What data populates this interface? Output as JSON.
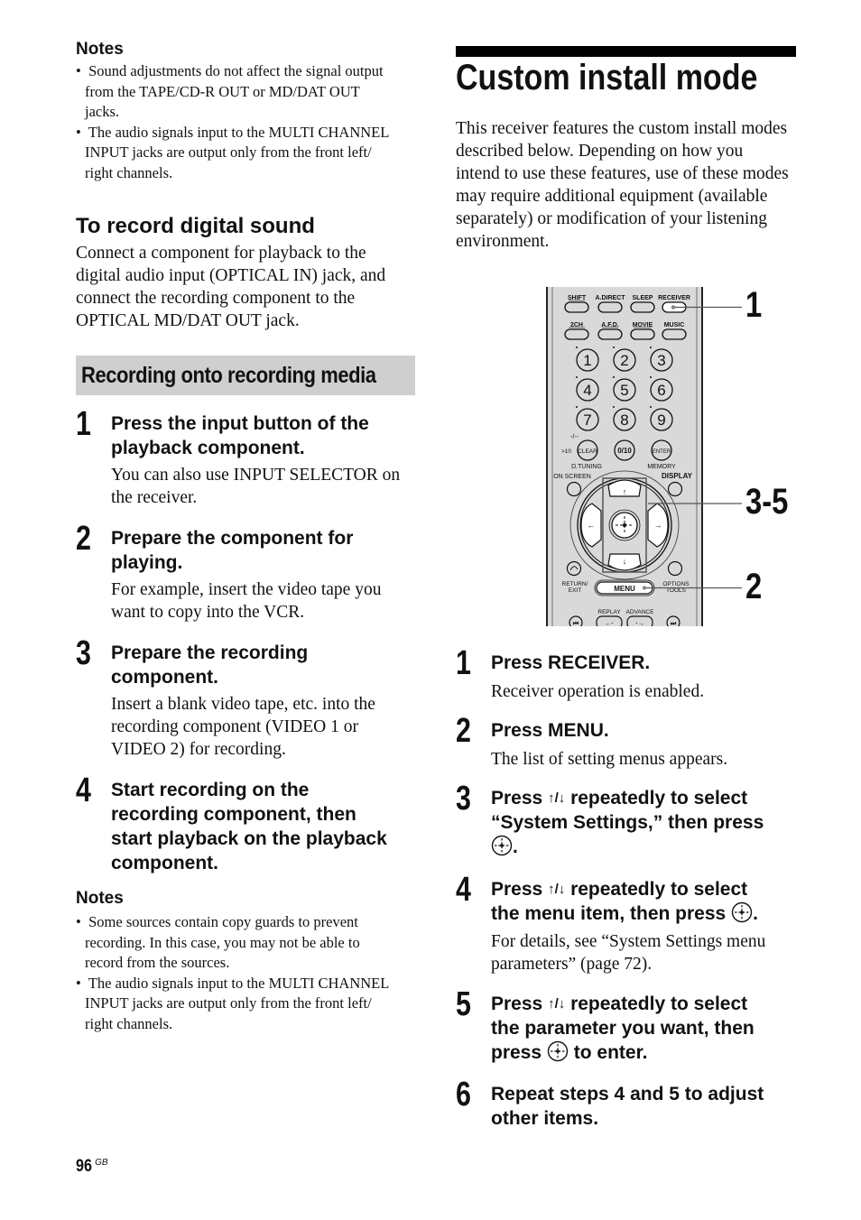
{
  "left": {
    "notes1": {
      "title": "Notes",
      "items": [
        [
          "Sound adjustments do not affect the signal output",
          "from the TAPE/CD-R OUT or MD/DAT OUT",
          "jacks."
        ],
        [
          "The audio signals input to the MULTI CHANNEL",
          "INPUT jacks are output only from the front left/",
          "right channels."
        ]
      ]
    },
    "digital": {
      "heading": "To record digital sound",
      "lines": [
        "Connect a component for playback to the",
        "digital audio input (OPTICAL IN) jack, and",
        "connect the recording component to the",
        "OPTICAL MD/DAT OUT jack."
      ]
    },
    "section_heading": "Recording onto recording media",
    "steps": [
      {
        "num": "1",
        "title": [
          "Press the input button of the",
          "playback component."
        ],
        "body": [
          "You can also use INPUT SELECTOR on",
          "the receiver."
        ]
      },
      {
        "num": "2",
        "title": [
          "Prepare the component for",
          "playing."
        ],
        "body": [
          "For example, insert the video tape you",
          "want to copy into the VCR."
        ]
      },
      {
        "num": "3",
        "title": [
          "Prepare the recording",
          "component."
        ],
        "body": [
          "Insert a blank video tape, etc. into the",
          "recording component (VIDEO 1 or",
          "VIDEO 2) for recording."
        ]
      },
      {
        "num": "4",
        "title": [
          "Start recording on the",
          "recording component, then",
          "start playback on the playback",
          "component."
        ],
        "body": []
      }
    ],
    "notes2": {
      "title": "Notes",
      "items": [
        [
          "Some sources contain copy guards to prevent",
          "recording. In this case, you may not be able to",
          "record from the sources."
        ],
        [
          "The audio signals input to the MULTI CHANNEL",
          "INPUT jacks are output only from the front left/",
          "right channels."
        ]
      ]
    }
  },
  "right": {
    "title": "Custom install mode",
    "intro": [
      "This receiver features the custom install modes",
      "described below. Depending on how you",
      "intend to use these features, use of these modes",
      "may require additional equipment (available",
      "separately) or modification of your listening",
      "environment."
    ],
    "remote": {
      "row1": [
        "SHIFT",
        "A.DIRECT",
        "SLEEP",
        "RECEIVER"
      ],
      "row2": [
        "2CH",
        "A.F.D.",
        "MOVIE",
        "MUSIC"
      ],
      "numpad": [
        "1",
        "2",
        "3",
        "4",
        "5",
        "6",
        "7",
        "8",
        "9"
      ],
      "bottom_row": {
        "dash": "-/--",
        "gt10": ">10",
        "clear": "CLEAR",
        "zero": "0/10",
        "enter": "ENTER"
      },
      "labels": {
        "dtuning": "D.TUNING",
        "memory": "MEMORY",
        "onscreen": "ON SCREEN",
        "display": "DISPLAY",
        "return": "RETURN/\nEXIT",
        "return1": "RETURN/",
        "return2": "EXIT",
        "options1": "OPTIONS",
        "options2": "TOOLS",
        "menu": "MENU",
        "replay": "REPLAY",
        "advance": "ADVANCE"
      },
      "callouts": [
        "1",
        "3-5",
        "2"
      ]
    },
    "steps": [
      {
        "num": "1",
        "title": [
          "Press RECEIVER."
        ],
        "body": [
          "Receiver operation is enabled."
        ]
      },
      {
        "num": "2",
        "title": [
          "Press MENU."
        ],
        "body": [
          "The list of setting menus appears."
        ]
      },
      {
        "num": "3",
        "title_a": "Press",
        "title_b": "repeatedly to select",
        "title_c": "“System Settings,” then press",
        "title_d": "."
      },
      {
        "num": "4",
        "title_a": "Press",
        "title_b": "repeatedly to select",
        "title_c": "the menu item, then press",
        "title_d": ".",
        "body": [
          "For details, see “System Settings menu",
          "parameters” (page 72)."
        ]
      },
      {
        "num": "5",
        "title_a": "Press",
        "title_b": "repeatedly to select",
        "title_c": "the parameter you want, then",
        "title_d_pre": "press",
        "title_d_post": "to enter."
      },
      {
        "num": "6",
        "title": [
          "Repeat steps 4 and 5 to adjust",
          "other items."
        ]
      }
    ],
    "arrow_symbol": "↑/↓"
  },
  "footer": {
    "page_number": "96",
    "region": "GB"
  }
}
